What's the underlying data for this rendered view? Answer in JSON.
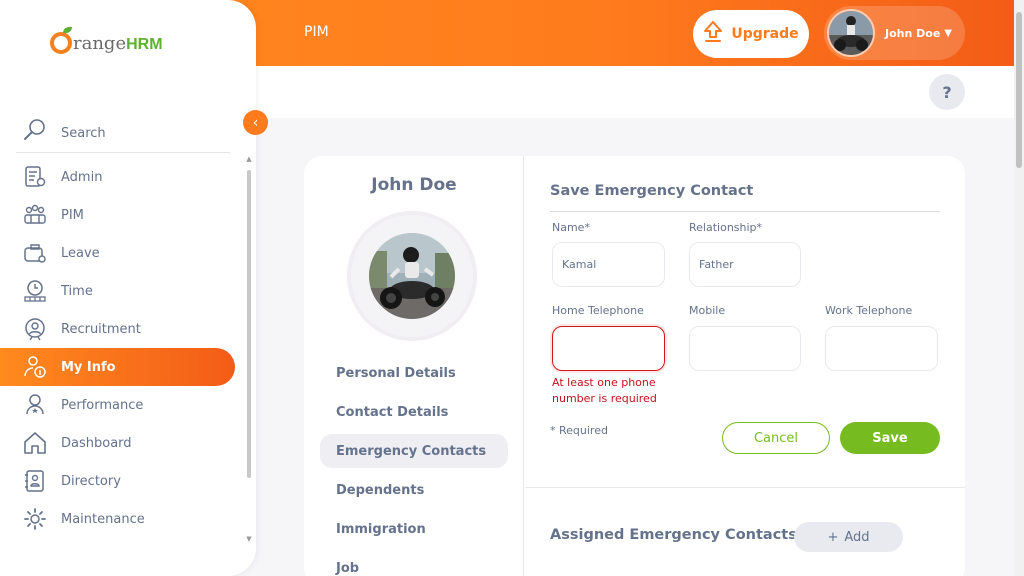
{
  "app": {
    "logo_text": "range",
    "logo_suffix": "HRM"
  },
  "header": {
    "module_title": "PIM",
    "upgrade_label": "Upgrade",
    "user_name": "John Doe",
    "help_label": "?"
  },
  "sidebar": {
    "search_label": "Search",
    "items": [
      {
        "label": "Admin",
        "icon": "admin-icon"
      },
      {
        "label": "PIM",
        "icon": "pim-icon"
      },
      {
        "label": "Leave",
        "icon": "leave-icon"
      },
      {
        "label": "Time",
        "icon": "time-icon"
      },
      {
        "label": "Recruitment",
        "icon": "recruitment-icon"
      },
      {
        "label": "My Info",
        "icon": "my-info-icon",
        "active": true
      },
      {
        "label": "Performance",
        "icon": "performance-icon"
      },
      {
        "label": "Dashboard",
        "icon": "dashboard-icon"
      },
      {
        "label": "Directory",
        "icon": "directory-icon"
      },
      {
        "label": "Maintenance",
        "icon": "maintenance-icon"
      }
    ]
  },
  "profile": {
    "name": "John Doe",
    "tabs": [
      {
        "label": "Personal Details"
      },
      {
        "label": "Contact Details"
      },
      {
        "label": "Emergency Contacts",
        "active": true
      },
      {
        "label": "Dependents"
      },
      {
        "label": "Immigration"
      },
      {
        "label": "Job"
      }
    ]
  },
  "form": {
    "title": "Save Emergency Contact",
    "name_label": "Name*",
    "name_value": "Kamal",
    "relationship_label": "Relationship*",
    "relationship_value": "Father",
    "home_label": "Home Telephone",
    "home_value": "",
    "mobile_label": "Mobile",
    "mobile_value": "",
    "work_label": "Work Telephone",
    "work_value": "",
    "error_line1": "At least one phone",
    "error_line2": "number is required",
    "required_note": "* Required",
    "cancel_label": "Cancel",
    "save_label": "Save"
  },
  "assigned": {
    "title": "Assigned Emergency Contacts",
    "add_label": "Add"
  },
  "colors": {
    "brand_orange": "#ff7b1d",
    "brand_green": "#76bc21",
    "error_red": "#c0141b",
    "text": "#64728c"
  }
}
